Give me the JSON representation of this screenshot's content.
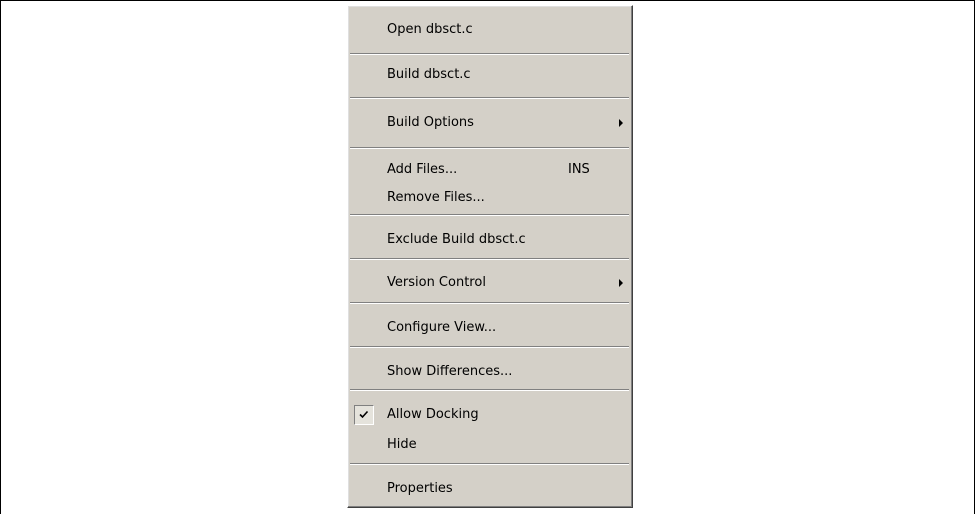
{
  "menu": {
    "open_label": "Open dbsct.c",
    "build_label": "Build dbsct.c",
    "build_options_label": "Build Options",
    "add_files_label": "Add Files...",
    "add_files_shortcut": "INS",
    "remove_files_label": "Remove Files...",
    "exclude_build_label": "Exclude Build dbsct.c",
    "version_control_label": "Version Control",
    "configure_view_label": "Configure View...",
    "show_differences_label": "Show Differences...",
    "allow_docking_label": "Allow Docking",
    "allow_docking_checked": true,
    "hide_label": "Hide",
    "properties_label": "Properties"
  },
  "icons": {
    "submenu": "chevron-right-icon",
    "check": "check-icon"
  }
}
